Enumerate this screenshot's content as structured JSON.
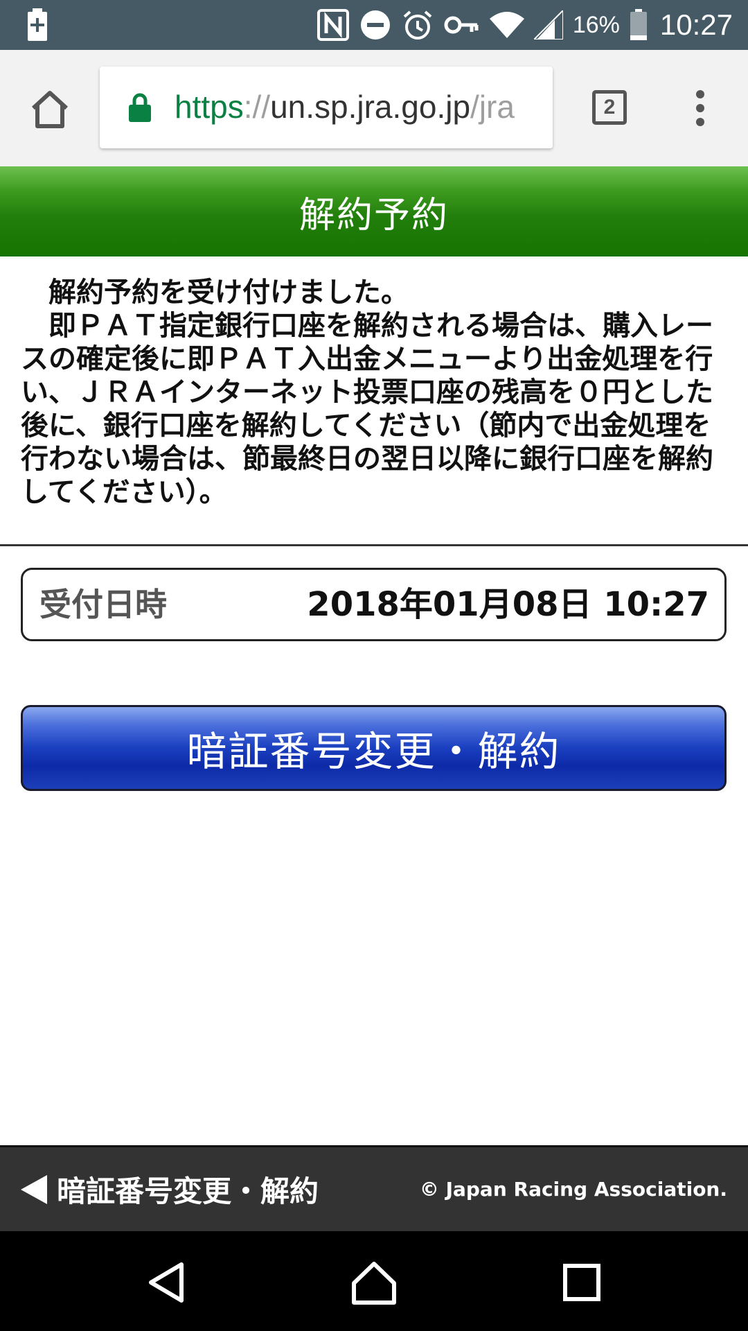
{
  "status_bar": {
    "battery_percent": "16%",
    "time": "10:27",
    "icons": [
      "battery-saver-icon",
      "nfc-icon",
      "do-not-disturb-icon",
      "alarm-icon",
      "vpn-key-icon",
      "wifi-icon",
      "signal-icon",
      "battery-icon"
    ]
  },
  "browser": {
    "url_scheme": "https",
    "url_separator": "://",
    "url_host": "un.sp.jra.go.jp",
    "url_path": "/jra",
    "tab_count": "2",
    "secure_color": "#0b8043"
  },
  "header": {
    "title": "解約予約",
    "color": "#237f0c"
  },
  "message": {
    "line1": "解約予約を受け付けました。",
    "line2": "即ＰＡＴ指定銀行口座を解約される場合は、購入レースの確定後に即ＰＡＴ入出金メニューより出金処理を行い、ＪＲＡインターネット投票口座の残高を０円とした後に、銀行口座を解約してください（節内で出金処理を行わない場合は、節最終日の翌日以降に銀行口座を解約してください）。"
  },
  "reception": {
    "label": "受付日時",
    "value": "2018年01月08日 10:27"
  },
  "main_button": {
    "label": "暗証番号変更・解約",
    "color": "#1a3fbf"
  },
  "footer": {
    "back_label": "暗証番号変更・解約",
    "copyright": "© Japan Racing Association."
  },
  "nav_bar": {
    "buttons": [
      "back-icon",
      "home-icon",
      "recents-icon"
    ]
  }
}
